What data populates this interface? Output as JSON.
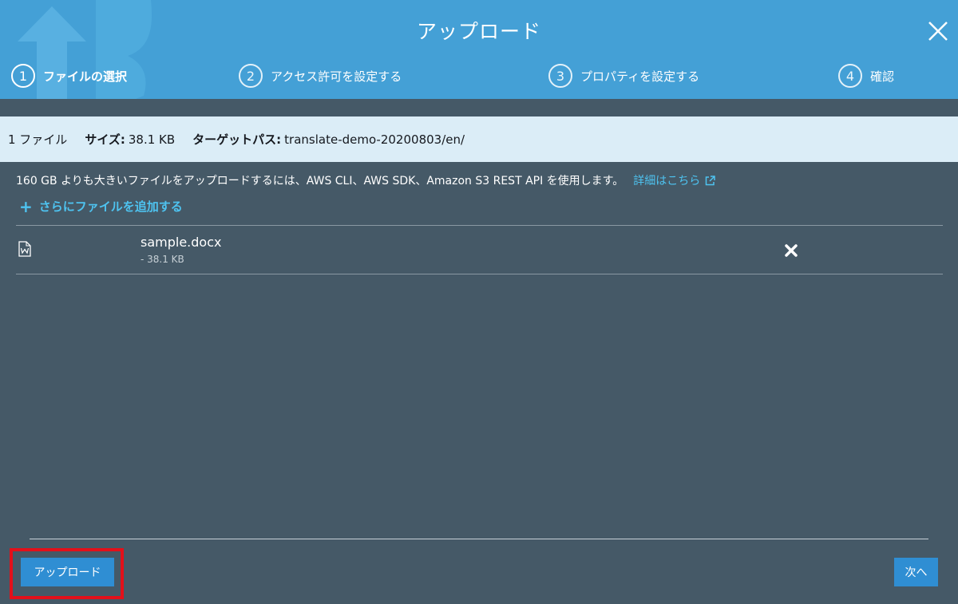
{
  "modal": {
    "title": "アップロード",
    "close_icon": "close-icon"
  },
  "steps": [
    {
      "number": "1",
      "label": "ファイルの選択",
      "active": true
    },
    {
      "number": "2",
      "label": "アクセス許可を設定する",
      "active": false
    },
    {
      "number": "3",
      "label": "プロパティを設定する",
      "active": false
    },
    {
      "number": "4",
      "label": "確認",
      "active": false
    }
  ],
  "summary": {
    "file_count": "1 ファイル",
    "size_label": "サイズ:",
    "size_value": "38.1 KB",
    "path_label": "ターゲットパス:",
    "path_value": "translate-demo-20200803/en/"
  },
  "notice": {
    "text": "160 GB よりも大きいファイルをアップロードするには、AWS CLI、AWS SDK、Amazon S3 REST API を使用します。",
    "link": "詳細はこちら",
    "link_icon": "external-link-icon"
  },
  "add_more": {
    "label": "さらにファイルを追加する",
    "icon": "plus-icon"
  },
  "files": [
    {
      "name": "sample.docx",
      "size": "- 38.1 KB",
      "icon": "word-document-icon",
      "remove_icon": "remove-icon"
    }
  ],
  "footer": {
    "upload_label": "アップロード",
    "next_label": "次へ"
  },
  "colors": {
    "header": "#44a0d6",
    "body": "#455967",
    "infobar": "#dbedf7",
    "link": "#4ec3f0",
    "button": "#2f8ed3",
    "highlight": "#e3101a"
  }
}
